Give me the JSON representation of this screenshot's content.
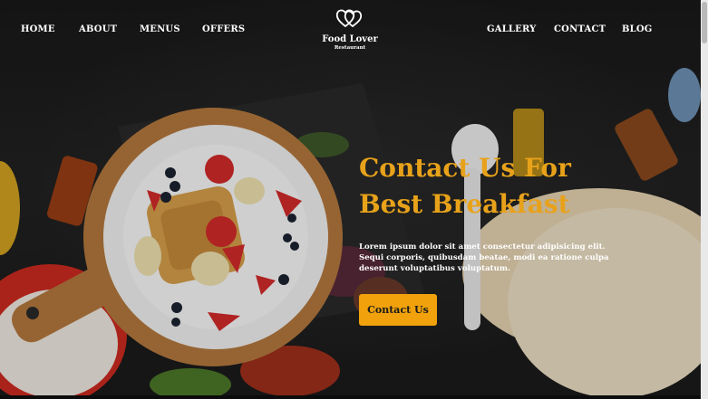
{
  "nav": {
    "left": [
      "HOME",
      "ABOUT",
      "MENUS",
      "OFFERS"
    ],
    "right": [
      "GALLERY",
      "CONTACT",
      "BLOG"
    ]
  },
  "logo": {
    "title": "Food Lover",
    "subtitle": "Restaurant",
    "icon": "double-heart-icon"
  },
  "hero": {
    "headline_lines": [
      "Contact Us For",
      "Best Breakfast"
    ],
    "description_lines": [
      "Lorem ipsum dolor sit amet consectetur adipisicing elit.",
      "Sequi corporis, quibusdam beatae, modi ea ratione culpa",
      "deserunt voluptatibus voluptatum."
    ],
    "cta_label": "Contact Us"
  },
  "colors": {
    "accent": "#f0a10c",
    "headline": "#e8a21a",
    "background": "#1b1b1b",
    "text": "#ffffff"
  }
}
